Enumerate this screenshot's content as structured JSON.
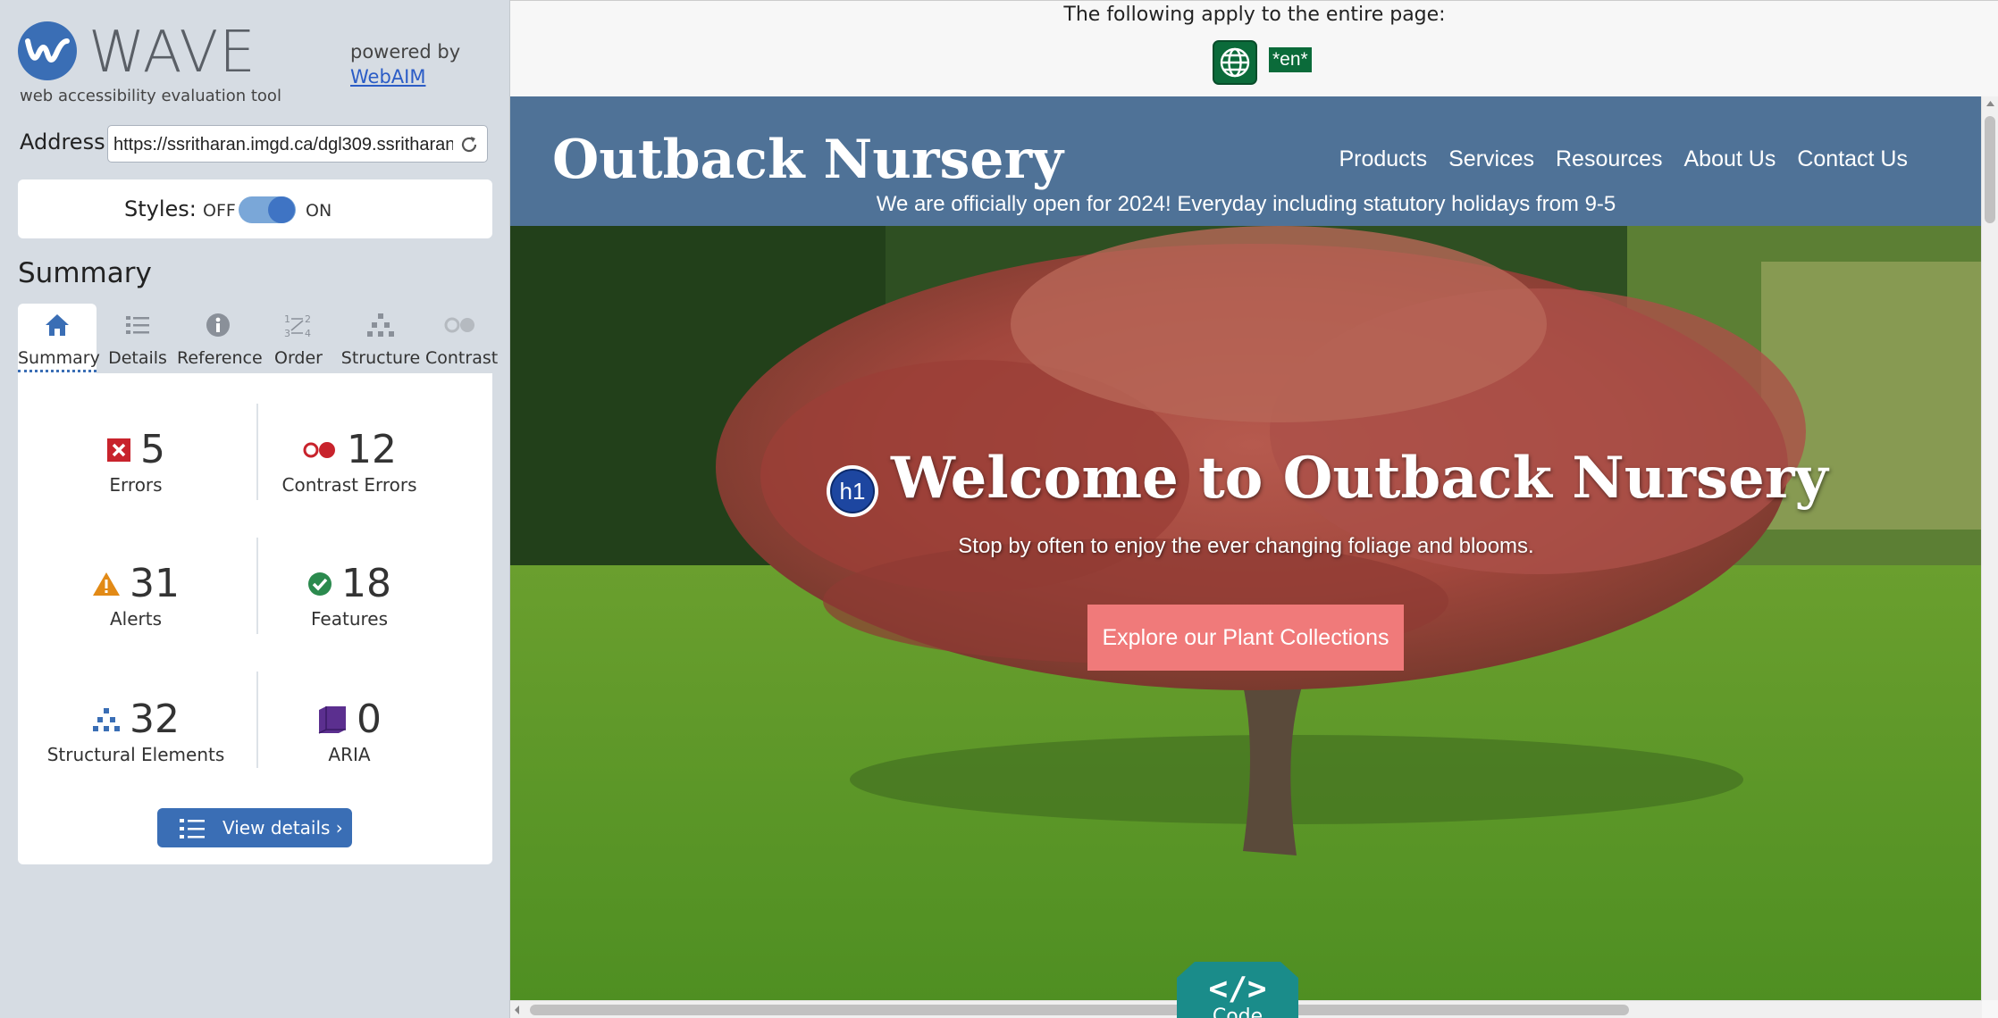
{
  "wave": {
    "logo_text": "WAVE",
    "logo_subtitle": "web accessibility evaluation tool",
    "powered_by": "powered by",
    "powered_link": "WebAIM",
    "address_label": "Address:",
    "address_value": "https://ssritharan.imgd.ca/dgl309.ssritharan",
    "styles_label": "Styles:",
    "styles_off": "OFF",
    "styles_on": "ON",
    "styles_state": "on",
    "summary_title": "Summary",
    "tabs": [
      {
        "label": "Summary",
        "icon": "home-icon",
        "active": true
      },
      {
        "label": "Details",
        "icon": "list-icon",
        "active": false
      },
      {
        "label": "Reference",
        "icon": "info-icon",
        "active": false
      },
      {
        "label": "Order",
        "icon": "order-icon",
        "active": false
      },
      {
        "label": "Structure",
        "icon": "structure-icon",
        "active": false
      },
      {
        "label": "Contrast",
        "icon": "contrast-icon",
        "active": false
      }
    ],
    "stats": {
      "errors": {
        "count": "5",
        "label": "Errors",
        "icon": "error-icon",
        "color": "#c8232c"
      },
      "contrast_errors": {
        "count": "12",
        "label": "Contrast Errors",
        "icon": "contrast-error-icon",
        "color": "#c8232c"
      },
      "alerts": {
        "count": "31",
        "label": "Alerts",
        "icon": "alert-icon",
        "color": "#e28a16"
      },
      "features": {
        "count": "18",
        "label": "Features",
        "icon": "feature-icon",
        "color": "#2b8a4e"
      },
      "structural": {
        "count": "32",
        "label": "Structural Elements",
        "icon": "structure-icon",
        "color": "#3a6eb5"
      },
      "aria": {
        "count": "0",
        "label": "ARIA",
        "icon": "aria-icon",
        "color": "#5b2f8f"
      }
    },
    "view_details_label": "View details ›"
  },
  "page": {
    "apply_text": "The following apply to the entire page:",
    "lang_badge": "*en*",
    "site": {
      "brand": "Outback Nursery",
      "nav": [
        "Products",
        "Services",
        "Resources",
        "About Us",
        "Contact Us"
      ],
      "announcement": "We are officially open for 2024! Everyday including statutory holidays from 9-5",
      "h1_badge": "h1",
      "hero_title": "Welcome to Outback Nursery",
      "hero_subtitle": "Stop by often to enjoy the ever changing foliage and blooms.",
      "cta_label": "Explore our Plant Collections"
    },
    "code_tab_icon": "</>",
    "code_tab_label": "Code"
  },
  "colors": {
    "wave_blue": "#3a6eb5",
    "sidebar_bg": "#d6dce3",
    "site_header": "#4f7297",
    "cta": "#f07a7a",
    "code_tab": "#1a8c8a",
    "wave_green": "#0b6b3a"
  }
}
